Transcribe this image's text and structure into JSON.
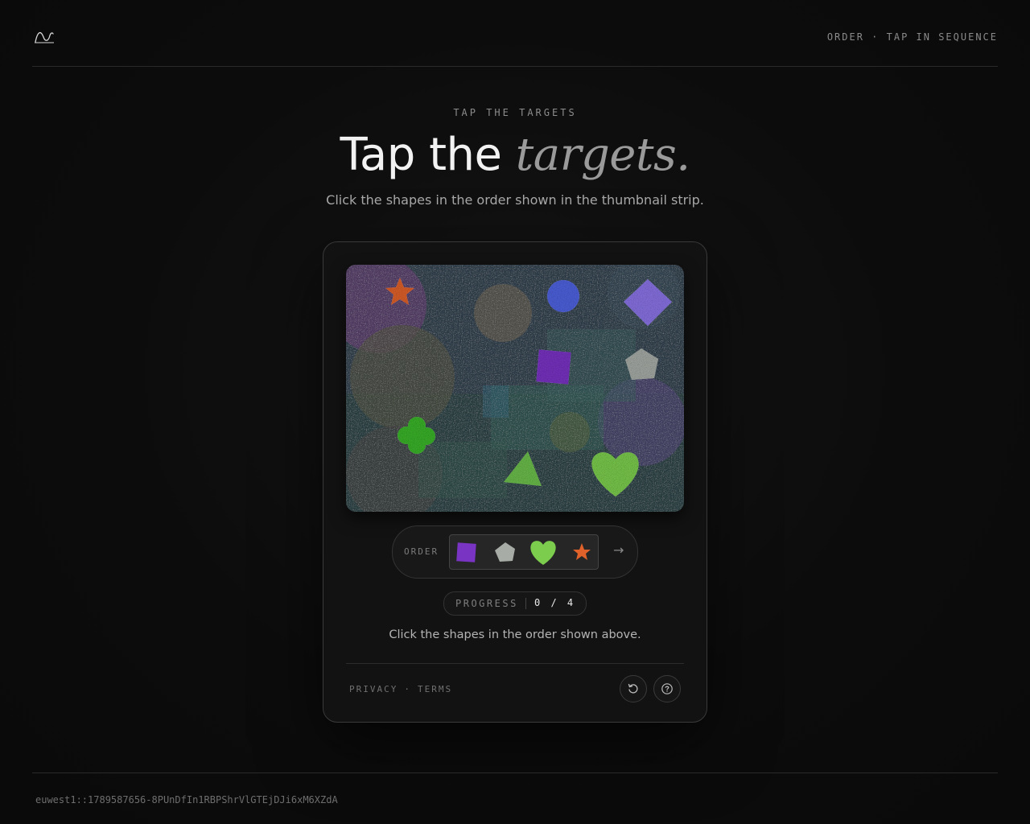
{
  "header": {
    "logo_icon": "wave-logo-icon",
    "nav_text": "ORDER · TAP IN SEQUENCE"
  },
  "hero": {
    "eyebrow": "TAP THE TARGETS",
    "headline_plain": "Tap the ",
    "headline_emphasis": "targets.",
    "subtitle": "Click the shapes in the order shown in the thumbnail strip."
  },
  "challenge": {
    "canvas_shapes": [
      {
        "name": "star",
        "color": "#e0622a"
      },
      {
        "name": "circle",
        "color": "#4f63e0"
      },
      {
        "name": "diamond",
        "color": "#8a74e6"
      },
      {
        "name": "square",
        "color": "#7a34c4"
      },
      {
        "name": "pentagon",
        "color": "#a7aca7"
      },
      {
        "name": "clover",
        "color": "#3bb52a"
      },
      {
        "name": "triangle",
        "color": "#6cbf4c"
      },
      {
        "name": "heart",
        "color": "#7ccd4e"
      }
    ],
    "order_label": "ORDER",
    "order": [
      {
        "name": "square",
        "color": "#7a34c4"
      },
      {
        "name": "pentagon",
        "color": "#a7aca7"
      },
      {
        "name": "heart",
        "color": "#7ccd4e"
      },
      {
        "name": "star",
        "color": "#e0622a"
      }
    ],
    "next_icon": "arrow-right-icon",
    "next_glyph": "→",
    "progress_label": "PROGRESS",
    "progress_value": "0 / 4",
    "progress_done": 0,
    "progress_total": 4,
    "instruction": "Click the shapes in the order shown above."
  },
  "footer": {
    "privacy": "PRIVACY",
    "separator": "·",
    "terms": "TERMS",
    "refresh_icon": "refresh-icon",
    "help_icon": "help-icon"
  },
  "session_id": "euwest1::1789587656-8PUnDfIn1RBPShrVlGTEjDJi6xM6XZdA"
}
